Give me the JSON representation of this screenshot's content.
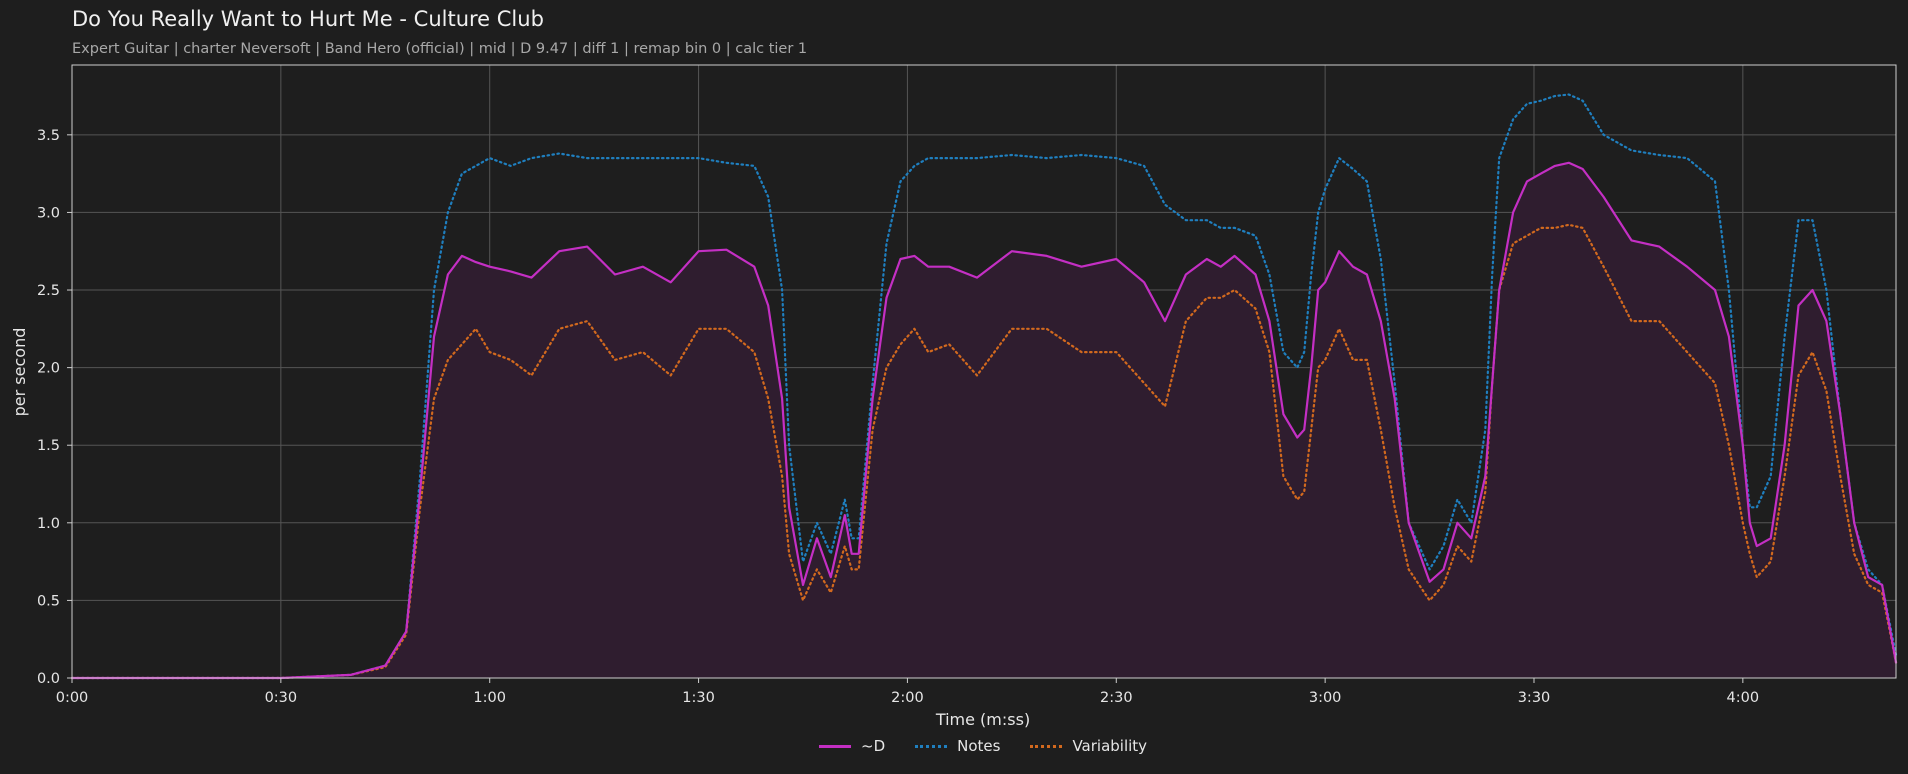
{
  "colors": {
    "background": "#1e1e1e",
    "D": "#c42fc4",
    "Notes": "#1f7fbf",
    "Variability": "#d2691e",
    "fill": "#2f1d2f",
    "grid": "#555555"
  },
  "chart_data": {
    "type": "line",
    "title": "Do You Really Want to Hurt Me - Culture Club",
    "subtitle": "Expert Guitar  |  charter Neversoft  |  Band Hero (official)  |  mid  |  D 9.47  |  diff 1  |  remap bin 0  |  calc tier 1",
    "xlabel": "Time (m:ss)",
    "ylabel": "per second",
    "xlim": [
      0,
      262
    ],
    "ylim": [
      0,
      3.95
    ],
    "grid": true,
    "legend_position": "bottom-center",
    "xticks": [
      0,
      30,
      60,
      90,
      120,
      150,
      180,
      210,
      240
    ],
    "xtick_labels": [
      "0:00",
      "0:30",
      "1:00",
      "1:30",
      "2:00",
      "2:30",
      "3:00",
      "3:30",
      "4:00"
    ],
    "yticks": [
      0,
      0.5,
      1,
      1.5,
      2,
      2.5,
      3,
      3.5
    ],
    "ytick_labels": [
      "0.0",
      "0.5",
      "1.0",
      "1.5",
      "2.0",
      "2.5",
      "3.0",
      "3.5"
    ],
    "x": [
      0,
      10,
      20,
      30,
      40,
      45,
      48,
      50,
      52,
      54,
      56,
      58,
      60,
      63,
      66,
      70,
      74,
      78,
      82,
      86,
      90,
      94,
      98,
      100,
      102,
      103,
      105,
      107,
      109,
      111,
      112,
      113,
      115,
      117,
      119,
      121,
      123,
      126,
      130,
      135,
      140,
      145,
      150,
      154,
      157,
      160,
      163,
      165,
      167,
      170,
      172,
      174,
      176,
      177,
      178,
      179,
      180,
      182,
      184,
      186,
      188,
      190,
      192,
      195,
      197,
      199,
      201,
      203,
      204,
      205,
      207,
      209,
      211,
      213,
      215,
      217,
      220,
      224,
      228,
      232,
      236,
      238,
      240,
      241,
      242,
      244,
      246,
      248,
      250,
      252,
      254,
      256,
      258,
      260,
      262
    ],
    "series": [
      {
        "name": "~D",
        "style": "solid",
        "values": [
          0,
          0,
          0,
          0,
          0.02,
          0.08,
          0.3,
          1.2,
          2.2,
          2.6,
          2.72,
          2.68,
          2.65,
          2.62,
          2.58,
          2.75,
          2.78,
          2.6,
          2.65,
          2.55,
          2.75,
          2.76,
          2.65,
          2.4,
          1.8,
          1.1,
          0.6,
          0.9,
          0.65,
          1.05,
          0.8,
          0.8,
          1.8,
          2.45,
          2.7,
          2.72,
          2.65,
          2.65,
          2.58,
          2.75,
          2.72,
          2.65,
          2.7,
          2.55,
          2.3,
          2.6,
          2.7,
          2.65,
          2.72,
          2.6,
          2.3,
          1.7,
          1.55,
          1.6,
          2.0,
          2.5,
          2.55,
          2.75,
          2.65,
          2.6,
          2.3,
          1.8,
          1.0,
          0.62,
          0.7,
          1.0,
          0.9,
          1.3,
          1.9,
          2.5,
          3.0,
          3.2,
          3.25,
          3.3,
          3.32,
          3.28,
          3.1,
          2.82,
          2.78,
          2.65,
          2.5,
          2.2,
          1.5,
          1.0,
          0.85,
          0.9,
          1.5,
          2.4,
          2.5,
          2.3,
          1.7,
          1.0,
          0.65,
          0.6,
          0.1
        ]
      },
      {
        "name": "Notes",
        "style": "dotted",
        "values": [
          0,
          0,
          0,
          0,
          0.02,
          0.08,
          0.3,
          1.3,
          2.5,
          3.0,
          3.25,
          3.3,
          3.35,
          3.3,
          3.35,
          3.38,
          3.35,
          3.35,
          3.35,
          3.35,
          3.35,
          3.32,
          3.3,
          3.1,
          2.5,
          1.5,
          0.75,
          1.0,
          0.8,
          1.15,
          0.9,
          0.9,
          1.9,
          2.8,
          3.2,
          3.3,
          3.35,
          3.35,
          3.35,
          3.37,
          3.35,
          3.37,
          3.35,
          3.3,
          3.05,
          2.95,
          2.95,
          2.9,
          2.9,
          2.85,
          2.6,
          2.1,
          2.0,
          2.1,
          2.6,
          3.0,
          3.15,
          3.35,
          3.28,
          3.2,
          2.7,
          1.9,
          1.0,
          0.7,
          0.85,
          1.15,
          1.0,
          1.6,
          2.6,
          3.35,
          3.6,
          3.7,
          3.72,
          3.75,
          3.76,
          3.72,
          3.5,
          3.4,
          3.37,
          3.35,
          3.2,
          2.5,
          1.5,
          1.1,
          1.1,
          1.3,
          2.2,
          2.95,
          2.95,
          2.5,
          1.7,
          1.0,
          0.7,
          0.6,
          0.15
        ]
      },
      {
        "name": "Variability",
        "style": "dotted",
        "values": [
          0,
          0,
          0,
          0,
          0.02,
          0.07,
          0.28,
          1.1,
          1.8,
          2.05,
          2.15,
          2.25,
          2.1,
          2.05,
          1.95,
          2.25,
          2.3,
          2.05,
          2.1,
          1.95,
          2.25,
          2.25,
          2.1,
          1.8,
          1.3,
          0.8,
          0.5,
          0.7,
          0.55,
          0.85,
          0.7,
          0.7,
          1.6,
          2.0,
          2.15,
          2.25,
          2.1,
          2.15,
          1.95,
          2.25,
          2.25,
          2.1,
          2.1,
          1.9,
          1.75,
          2.3,
          2.45,
          2.45,
          2.5,
          2.38,
          2.1,
          1.3,
          1.15,
          1.2,
          1.6,
          2.0,
          2.05,
          2.25,
          2.05,
          2.05,
          1.6,
          1.1,
          0.7,
          0.5,
          0.6,
          0.85,
          0.75,
          1.2,
          1.9,
          2.5,
          2.8,
          2.85,
          2.9,
          2.9,
          2.92,
          2.9,
          2.65,
          2.3,
          2.3,
          2.1,
          1.9,
          1.5,
          1.0,
          0.8,
          0.65,
          0.75,
          1.3,
          1.95,
          2.1,
          1.85,
          1.3,
          0.8,
          0.6,
          0.55,
          0.1
        ]
      }
    ]
  }
}
